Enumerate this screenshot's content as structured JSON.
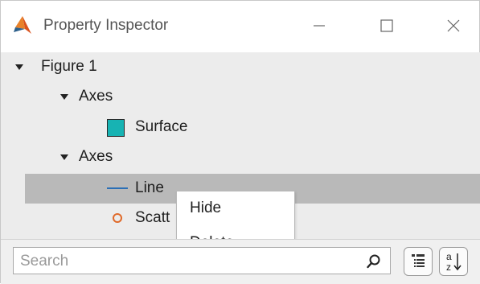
{
  "window": {
    "title": "Property Inspector"
  },
  "tree": {
    "figure_label": "Figure 1",
    "axes1_label": "Axes",
    "surface_label": "Surface",
    "axes2_label": "Axes",
    "line_label": "Line",
    "scatter_label": "Scatt"
  },
  "context_menu": {
    "hide_label": "Hide",
    "delete_label": "Delete"
  },
  "search": {
    "placeholder": "Search"
  },
  "colors": {
    "selected_row": "#b9b9b9",
    "surface_swatch": "#17b3b3",
    "line_icon": "#2b6fb6",
    "scatter_icon": "#e06a2a"
  },
  "icons": [
    "matlab-logo-icon",
    "minimize-icon",
    "maximize-icon",
    "close-icon",
    "caret-down-icon",
    "surface-swatch-icon",
    "line-icon",
    "scatter-circle-icon",
    "search-icon",
    "group-properties-icon",
    "sort-alpha-icon"
  ]
}
